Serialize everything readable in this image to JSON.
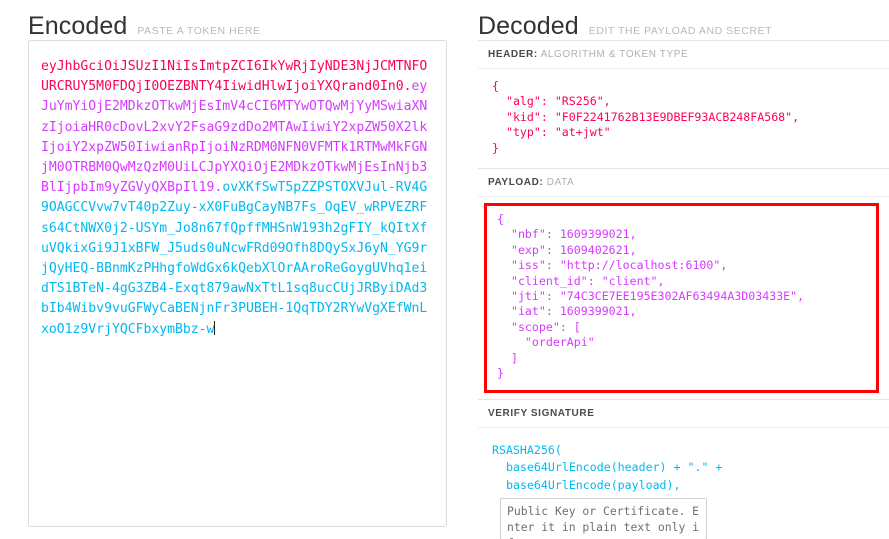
{
  "encoded": {
    "title": "Encoded",
    "subtitle": "PASTE A TOKEN HERE",
    "token_header": "eyJhbGciOiJSUzI1NiIsImtpZCI6IkYwRjIyNDE3NjJCMTNFOURCRUY5M0FDQjI0OEZBNTY4IiwidHlwIjoiYXQrand0In0",
    "token_payload": "eyJuYmYiOjE2MDkzOTkwMjEsImV4cCI6MTYwOTQwMjYyMSwiaXNzIjoiaHR0cDovL2xvY2FsaG9zdDo2MTAwIiwiY2xpZW50X2lkIjoiY2xpZW50IiwianRpIjoiNzRDM0NFN0VFMTk1RTMwMkFGNjM0OTRBM0QwMzQzM0UiLCJpYXQiOjE2MDkzOTkwMjEsInNjb3BlIjpbIm9yZGVyQXBpIl19",
    "token_signature": "ovXKfSwT5pZZPSTOXVJul-RV4G9OAGCCVvw7vT40p2Zuy-xX0FuBgCayNB7Fs_OqEV_wRPVEZRFs64CtNWX0j2-USYm_Jo8n67fQpffMHSnW193h2gFIY_kQItXfuVQkixGi9J1xBFW_J5uds0uNcwFRd09Ofh8DQySxJ6yN_YG9rjQyHEQ-BBnmKzPHhgfoWdGx6kQebXlOrAAroReGoygUVhq1eidTS1BTeN-4gG3ZB4-Exqt879awNxTtL1sq8ucCUjJRByiDAd3bIb4Wibv9vuGFWyCaBENjnFr3PUBEH-1QqTDY2RYwVgXEfWnLxoO1z9VrjYQCFbxymBbz-w",
    "separator": "."
  },
  "decoded": {
    "title": "Decoded",
    "subtitle": "EDIT THE PAYLOAD AND SECRET",
    "header_panel": {
      "label_strong": "HEADER:",
      "label_light": "ALGORITHM & TOKEN TYPE",
      "lines": [
        "{",
        "  \"alg\": \"RS256\",",
        "  \"kid\": \"F0F2241762B13E9DBEF93ACB248FA568\",",
        "  \"typ\": \"at+jwt\"",
        "}"
      ]
    },
    "payload_panel": {
      "label_strong": "PAYLOAD:",
      "label_light": "DATA",
      "highlighted": true,
      "highlight_color": "#ff0000",
      "lines": [
        "{",
        "  \"nbf\": 1609399021,",
        "  \"exp\": 1609402621,",
        "  \"iss\": \"http://localhost:6100\",",
        "  \"client_id\": \"client\",",
        "  \"jti\": \"74C3CE7EE195E302AF63494A3D03433E\",",
        "  \"iat\": 1609399021,",
        "  \"scope\": [",
        "    \"orderApi\"",
        "  ]",
        "}"
      ]
    },
    "verify_panel": {
      "label_strong": "VERIFY SIGNATURE",
      "label_light": "",
      "algorithm_line": "RSASHA256(",
      "line_2": "base64UrlEncode(header) + \".\" +",
      "line_3": "base64UrlEncode(payload),",
      "public_key_placeholder": "Public Key or Certificate. Enter it in plain text only if yo"
    }
  },
  "colors": {
    "token_header": "#fb015b",
    "token_payload": "#d63aff",
    "token_signature": "#00b9f1",
    "highlight_border": "#ff0000"
  }
}
